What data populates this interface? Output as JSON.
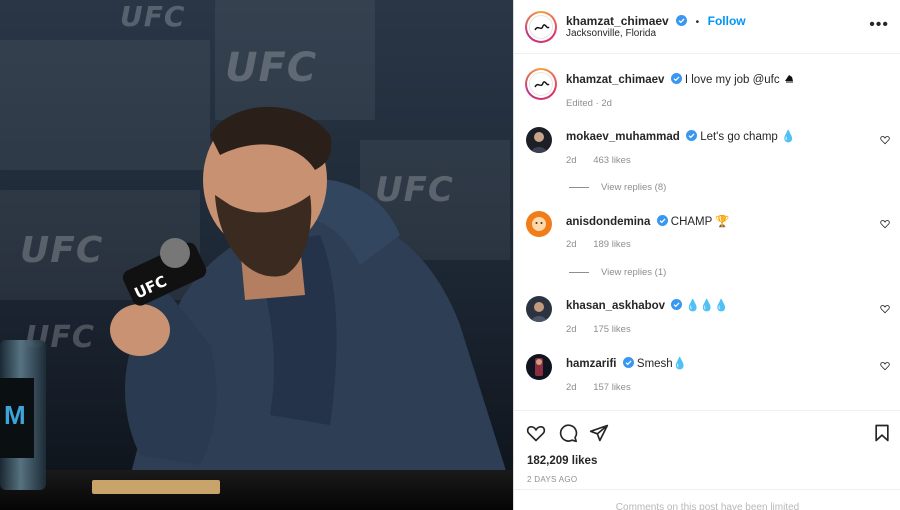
{
  "post": {
    "author": "khamzat_chimaev",
    "follow_label": "Follow",
    "location": "Jacksonville, Florida",
    "caption_text": "I love my job @ufc",
    "caption_meta": "Edited · 2d",
    "likes": "182,209 likes",
    "timestamp": "2 DAYS AGO",
    "comments_limited": "Comments on this post have been limited"
  },
  "photo": {
    "banner_words": [
      "UFC",
      "UFC",
      "UFC",
      "UFC",
      "UFC"
    ]
  },
  "comments": [
    {
      "username": "mokaev_muhammad",
      "text": "Let's go champ",
      "emoji": "💧",
      "age": "2d",
      "likes": "463 likes",
      "replies": "View replies (8)"
    },
    {
      "username": "anisdondemina",
      "text": "CHAMP",
      "emoji": "🏆",
      "age": "2d",
      "likes": "189 likes",
      "replies": "View replies (1)"
    },
    {
      "username": "khasan_askhabov",
      "text": "",
      "emoji": "💧💧💧",
      "age": "2d",
      "likes": "175 likes",
      "replies": ""
    },
    {
      "username": "hamzarifi",
      "text": "Smesh",
      "emoji": "💧",
      "age": "2d",
      "likes": "157 likes",
      "replies": ""
    }
  ],
  "icons": {
    "verified": "verified-badge-icon",
    "more": "more-options-icon",
    "heart": "heart-icon",
    "comment": "comment-icon",
    "share": "send-icon",
    "save": "bookmark-icon"
  },
  "colors": {
    "accent": "#0095f6",
    "verified": "#3897f0",
    "muted": "#8e8e8e"
  }
}
